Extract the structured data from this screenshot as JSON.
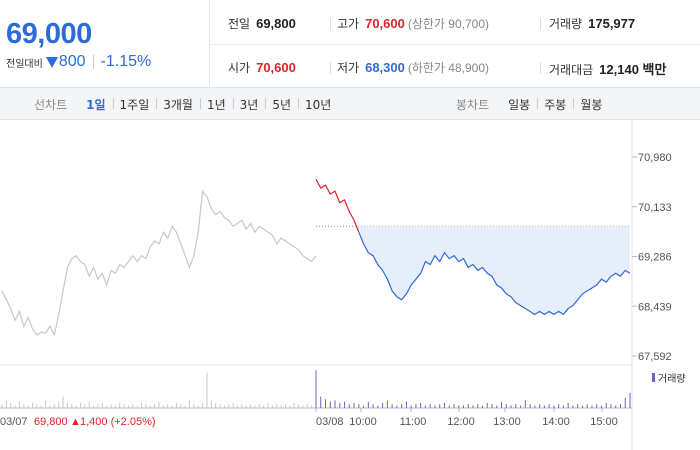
{
  "price": {
    "current": "69,000",
    "change_label": "전일대비",
    "change": "800",
    "change_pct": "-1.15%"
  },
  "stats": {
    "prev_close_label": "전일",
    "prev_close": "69,800",
    "high_label": "고가",
    "high": "70,600",
    "upper_limit": "(상한가 90,700)",
    "volume_label": "거래량",
    "volume": "175,977",
    "open_label": "시가",
    "open": "70,600",
    "low_label": "저가",
    "low": "68,300",
    "lower_limit": "(하한가 48,900)",
    "amount_label": "거래대금",
    "amount": "12,140 백만"
  },
  "toolbar": {
    "line_label": "선차트",
    "periods": [
      "1일",
      "1주일",
      "3개월",
      "1년",
      "3년",
      "5년",
      "10년"
    ],
    "active_period": "1일",
    "candle_label": "봉차트",
    "candles": [
      "일봉",
      "주봉",
      "월봉"
    ]
  },
  "colors": {
    "down": "#2d6bd6",
    "up": "#e0222a",
    "prev_day_line": "#c8c8c8",
    "fill": "#e6eef9"
  },
  "chart_data": {
    "type": "line",
    "y_ticks": [
      "70,980",
      "70,133",
      "69,286",
      "68,439",
      "67,592"
    ],
    "y_tick_values": [
      70980,
      70133,
      69286,
      68439,
      67592
    ],
    "ylim": [
      67592,
      70980
    ],
    "reference_price": 69800,
    "prev_day": {
      "date": "03/07",
      "close_text": "69,800",
      "change_text": "1,400 (+2.05%)",
      "up_symbol": "▲",
      "values": [
        68700,
        68550,
        68400,
        68200,
        68350,
        68100,
        68250,
        68050,
        67950,
        68000,
        67980,
        68100,
        67950,
        68300,
        68700,
        69100,
        69250,
        69300,
        69200,
        69150,
        68950,
        69100,
        68900,
        69000,
        68800,
        69050,
        69000,
        69150,
        69100,
        69200,
        69300,
        69200,
        69300,
        69250,
        69450,
        69550,
        69500,
        69700,
        69600,
        69800,
        69700,
        69500,
        69300,
        69100,
        69300,
        69700,
        70400,
        70300,
        70100,
        70000,
        70050,
        69950,
        69900,
        69800,
        69850,
        69900,
        69750,
        69850,
        69700,
        69800,
        69750,
        69700,
        69650,
        69500,
        69600,
        69550,
        69500,
        69450,
        69400,
        69300,
        69250,
        69200,
        69300
      ]
    },
    "today": {
      "date": "03/08",
      "x_ticks": [
        "10:00",
        "11:00",
        "12:00",
        "13:00",
        "14:00",
        "15:00"
      ],
      "values": [
        70600,
        70450,
        70500,
        70350,
        70400,
        70200,
        70250,
        70050,
        69900,
        69700,
        69500,
        69350,
        69300,
        69150,
        69050,
        68900,
        68700,
        68600,
        68550,
        68650,
        68800,
        68900,
        69000,
        69200,
        69150,
        69300,
        69200,
        69350,
        69250,
        69300,
        69200,
        69250,
        69100,
        69150,
        69050,
        69100,
        69000,
        68950,
        68800,
        68750,
        68650,
        68600,
        68500,
        68450,
        68400,
        68350,
        68300,
        68350,
        68300,
        68350,
        68300,
        68350,
        68300,
        68400,
        68450,
        68550,
        68650,
        68700,
        68750,
        68800,
        68900,
        68850,
        68950,
        69000,
        68950,
        69050,
        69000
      ]
    },
    "volume_label": "거래량",
    "prev_day_volume": [
      3,
      6,
      4,
      2,
      5,
      3,
      2,
      4,
      3,
      2,
      6,
      2,
      3,
      5,
      9,
      4,
      3,
      2,
      4,
      3,
      5,
      2,
      3,
      4,
      2,
      3,
      2,
      4,
      3,
      2,
      3,
      2,
      4,
      3,
      2,
      3,
      5,
      2,
      3,
      2,
      4,
      3,
      2,
      6,
      3,
      2,
      4,
      28,
      6,
      4,
      3,
      2,
      3,
      4,
      2,
      3,
      2,
      3,
      2,
      3,
      2,
      4,
      2,
      3,
      2,
      3,
      2,
      4,
      3,
      2,
      3,
      2,
      2
    ],
    "today_volume": [
      30,
      9,
      7,
      5,
      6,
      4,
      5,
      3,
      4,
      3,
      2,
      5,
      3,
      2,
      4,
      6,
      3,
      2,
      3,
      5,
      2,
      3,
      4,
      2,
      3,
      2,
      3,
      4,
      2,
      3,
      2,
      2,
      3,
      2,
      3,
      2,
      4,
      3,
      2,
      5,
      3,
      2,
      3,
      2,
      6,
      3,
      2,
      3,
      2,
      3,
      2,
      3,
      2,
      4,
      2,
      3,
      2,
      3,
      2,
      3,
      2,
      4,
      3,
      2,
      3,
      8,
      12
    ]
  }
}
